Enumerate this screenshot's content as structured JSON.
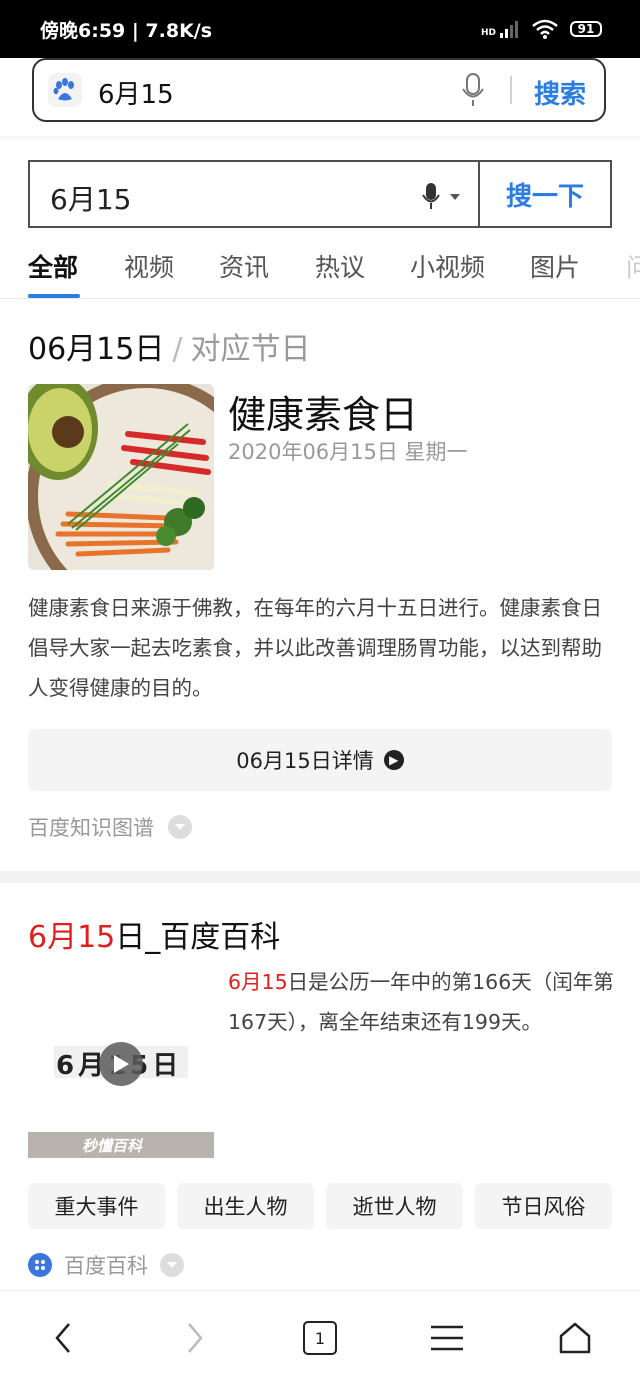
{
  "status_bar": {
    "time_speed": "傍晚6:59 | 7.8K/s",
    "hd_label": "HD",
    "battery": "91"
  },
  "url_bar": {
    "query": "6月15",
    "search_label": "搜索"
  },
  "search_box": {
    "query": "6月15",
    "button": "搜一下"
  },
  "tabs": [
    "全部",
    "视频",
    "资讯",
    "热议",
    "小视频",
    "图片",
    "问"
  ],
  "card1": {
    "date": "06月15日",
    "separator": "/",
    "subtitle": "对应节日",
    "festival": "健康素食日",
    "festival_date": "2020年06月15日 星期一",
    "description": "健康素食日来源于佛教，在每年的六月十五日进行。健康素食日倡导大家一起去吃素食，并以此改善调理肠胃功能，以达到帮助人变得健康的目的。",
    "detail_button": "06月15日详情",
    "source": "百度知识图谱"
  },
  "card2": {
    "title_red": "6月15",
    "title_rest": "日_百度百科",
    "text_red": "6月15",
    "text_rest": "日是公历一年中的第166天（闰年第167天），离全年结束还有199天。",
    "thumb_caption": "6月15日",
    "thumb_brand": "秒懂百科",
    "chips": [
      "重大事件",
      "出生人物",
      "逝世人物",
      "节日风俗"
    ],
    "source": "百度百科"
  },
  "bottom_nav": {
    "tab_count": "1"
  },
  "colors": {
    "accent": "#2b7de1",
    "highlight": "#e02020"
  }
}
